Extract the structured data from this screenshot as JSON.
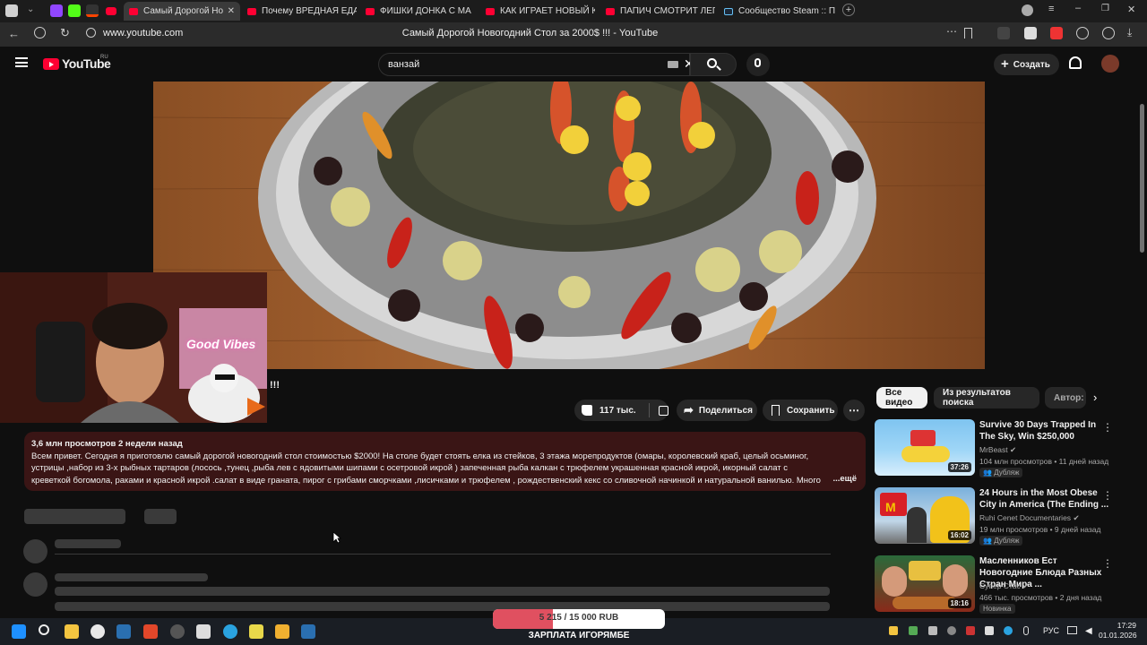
{
  "browser": {
    "tabs": [
      {
        "label": "Самый Дорогой Но"
      },
      {
        "label": "Почему ВРЕДНАЯ ЕДА т"
      },
      {
        "label": "ФИШКИ ДОНКА С МА"
      },
      {
        "label": "КАК ИГРАЕТ НОВЫЙ КАС"
      },
      {
        "label": "ПАПИЧ СМОТРИТ ЛЕГЕН"
      },
      {
        "label": "Сообщество Steam :: Пре"
      }
    ],
    "url": "www.youtube.com",
    "page_title": "Самый Дорогой Новогодний Стол за 2000$ !!! - YouTube"
  },
  "youtube": {
    "logo_text": "YouTube",
    "region": "RU",
    "search_value": "ванзай",
    "create_label": "Создать"
  },
  "video": {
    "title_fragment": "!!!",
    "likes": "117 тыс.",
    "share_label": "Поделиться",
    "save_label": "Сохранить",
    "stats": "3,6 млн просмотров  2 недели назад",
    "description": "Всем привет. Сегодня я приготовлю самый дорогой новогодний стол стоимостью $2000! На столе будет стоять елка из стейков, 3 этажа морепродуктов (омары, королевский краб, целый осьминог, устрицы ,набор из 3-х рыбных тартаров (лосось ,тунец ,рыба лев с ядовитыми шипами с осетровой икрой ) запеченная рыба калкан с трюфелем украшенная красной икрой, икорный салат с креветкой богомола, раками и красной икрой .салат в виде граната, пирог с грибами сморчками ,лисичками и трюфелем , рождественский кекс со сливочной начинкой и натуральной ванилью. Много элитного алкоголя и",
    "more_label": "...ещё"
  },
  "filters": {
    "chips": [
      "Все видео",
      "Из результатов поиска",
      "Автор:"
    ]
  },
  "recommendations": [
    {
      "title": "Survive 30 Days Trapped In The Sky, Win $250,000",
      "channel": "MrBeast",
      "meta": "104 млн просмотров • 11 дней назад",
      "badge": "Дубляж",
      "duration": "37:26"
    },
    {
      "title": "24 Hours in the Most Obese City in America (The Ending ...",
      "channel": "Ruhi Cenet Documentaries",
      "meta": "19 млн просмотров • 9 дней назад",
      "badge": "Дубляж",
      "duration": "16:02"
    },
    {
      "title": "Масленников Ест Новогодние Блюда Разных Стран Мира ...",
      "channel": "Супер Стас",
      "meta": "466 тыс. просмотров • 2 дня назад",
      "badge": "Новинка",
      "duration": "18:16"
    }
  ],
  "overlay": {
    "donation_goal": "5 215 / 15 000 RUB",
    "donation_progress": 0.348,
    "donation_caption": "ЗАРПЛАТА ИГОРЯМБЕ",
    "webcam_sign": "Good Vibes"
  },
  "taskbar": {
    "lang": "РУС",
    "time": "17:29",
    "date": "01.01.2026"
  },
  "colors": {
    "accent_red": "#ff0033",
    "desc_bg": "#3a1515",
    "progress_fill": "#e05060"
  }
}
